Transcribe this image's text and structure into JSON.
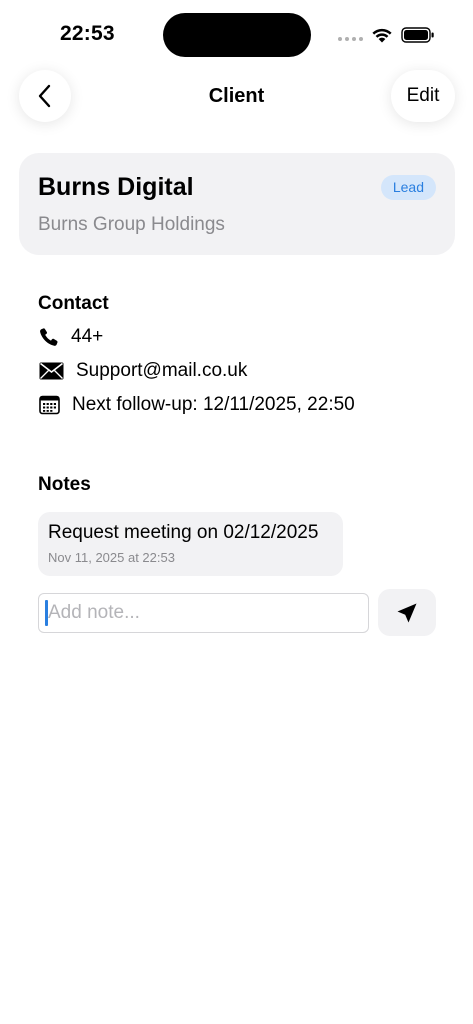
{
  "status_bar": {
    "time": "22:53"
  },
  "nav": {
    "title": "Client",
    "edit_label": "Edit"
  },
  "client": {
    "name": "Burns Digital",
    "company": "Burns Group Holdings",
    "badge": "Lead"
  },
  "contact": {
    "title": "Contact",
    "phone": "44+",
    "email": "Support@mail.co.uk",
    "follow_up": "Next follow-up: 12/11/2025, 22:50"
  },
  "notes": {
    "title": "Notes",
    "items": [
      {
        "text": "Request meeting on 02/12/2025",
        "timestamp": "Nov 11, 2025 at 22:53"
      }
    ],
    "input_placeholder": "Add note..."
  },
  "colors": {
    "accent": "#2a7fe0",
    "badge_bg": "#d4e6fb",
    "card_bg": "#f2f2f4",
    "muted_text": "#8a8a8e"
  },
  "icons": {
    "back": "chevron-left-icon",
    "phone": "phone-icon",
    "email": "envelope-icon",
    "calendar": "calendar-icon",
    "send": "paper-plane-icon",
    "wifi": "wifi-icon",
    "battery": "battery-icon"
  }
}
